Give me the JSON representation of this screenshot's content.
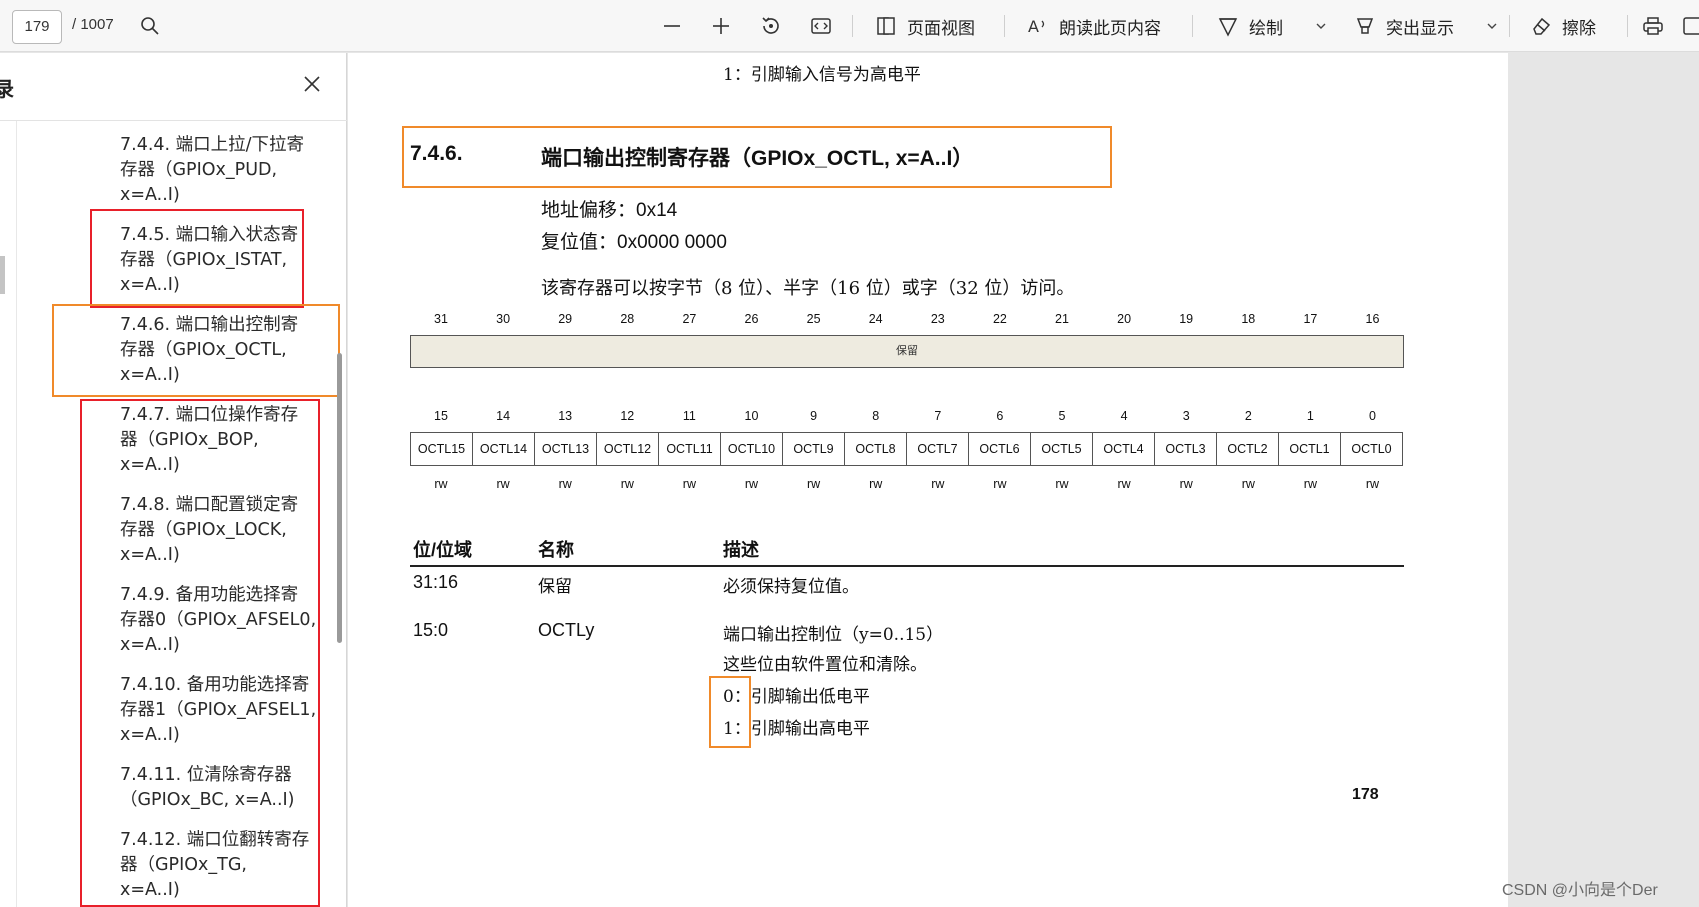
{
  "toolbar": {
    "page_current": "179",
    "page_total": "/ 1007",
    "page_view_label": "页面视图",
    "read_aloud_label": "朗读此页内容",
    "draw_label": "绘制",
    "highlight_label": "突出显示",
    "erase_label": "擦除"
  },
  "sidebar": {
    "title": "录",
    "items": [
      {
        "l1": "7.4.4. 端口上拉/下拉寄",
        "l2": "存器（GPIOx_PUD,",
        "l3": "x=A..I)"
      },
      {
        "l1": "7.4.5. 端口输入状态寄",
        "l2": "存器（GPIOx_ISTAT,",
        "l3": "x=A..I)"
      },
      {
        "l1": "7.4.6. 端口输出控制寄",
        "l2": "存器（GPIOx_OCTL,",
        "l3": "x=A..I)"
      },
      {
        "l1": "7.4.7. 端口位操作寄存",
        "l2": "器（GPIOx_BOP,",
        "l3": "x=A..I)"
      },
      {
        "l1": "7.4.8. 端口配置锁定寄",
        "l2": "存器（GPIOx_LOCK,",
        "l3": "x=A..I)"
      },
      {
        "l1": "7.4.9. 备用功能选择寄",
        "l2": "存器0（GPIOx_AFSEL0,",
        "l3": "x=A..I)"
      },
      {
        "l1": "7.4.10. 备用功能选择寄",
        "l2": "存器1（GPIOx_AFSEL1,",
        "l3": "x=A..I)"
      },
      {
        "l1": "7.4.11. 位清除寄存器",
        "l2": "（GPIOx_BC, x=A..I)",
        "l3": ""
      },
      {
        "l1": "7.4.12. 端口位翻转寄存",
        "l2": "器（GPIOx_TG,",
        "l3": "x=A..I)"
      }
    ]
  },
  "doc": {
    "top_line": "1：引脚输入信号为高电平",
    "section_number": "7.4.6.",
    "section_title": "端口输出控制寄存器（GPIOx_OCTL, x=A..I）",
    "address_offset": "地址偏移：0x14",
    "reset_value": "复位值：0x0000 0000",
    "access_note": "该寄存器可以按字节（8 位）、半字（16 位）或字（32 位）访问。",
    "upper_bits": [
      "31",
      "30",
      "29",
      "28",
      "27",
      "26",
      "25",
      "24",
      "23",
      "22",
      "21",
      "20",
      "19",
      "18",
      "17",
      "16"
    ],
    "reserved_label": "保留",
    "lower_bits": [
      "15",
      "14",
      "13",
      "12",
      "11",
      "10",
      "9",
      "8",
      "7",
      "6",
      "5",
      "4",
      "3",
      "2",
      "1",
      "0"
    ],
    "fields": [
      "OCTL15",
      "OCTL14",
      "OCTL13",
      "OCTL12",
      "OCTL11",
      "OCTL10",
      "OCTL9",
      "OCTL8",
      "OCTL7",
      "OCTL6",
      "OCTL5",
      "OCTL4",
      "OCTL3",
      "OCTL2",
      "OCTL1",
      "OCTL0"
    ],
    "access": [
      "rw",
      "rw",
      "rw",
      "rw",
      "rw",
      "rw",
      "rw",
      "rw",
      "rw",
      "rw",
      "rw",
      "rw",
      "rw",
      "rw",
      "rw",
      "rw"
    ],
    "table_headers": {
      "bits": "位/位域",
      "name": "名称",
      "desc": "描述"
    },
    "rows": [
      {
        "bits": "31:16",
        "name": "保留",
        "desc": "必须保持复位值。"
      },
      {
        "bits": "15:0",
        "name": "OCTLy",
        "desc1": "端口输出控制位（y=0..15）",
        "desc2": "这些位由软件置位和清除。",
        "v0": "0：引脚输出低电平",
        "v1": "1：引脚输出高电平"
      }
    ],
    "page_number": "178"
  },
  "watermark": "CSDN @小向是个Der",
  "colors": {
    "highlight_red": "#e8202a",
    "highlight_orange": "#f08a2a",
    "reserved_fill": "#eeebe0"
  }
}
